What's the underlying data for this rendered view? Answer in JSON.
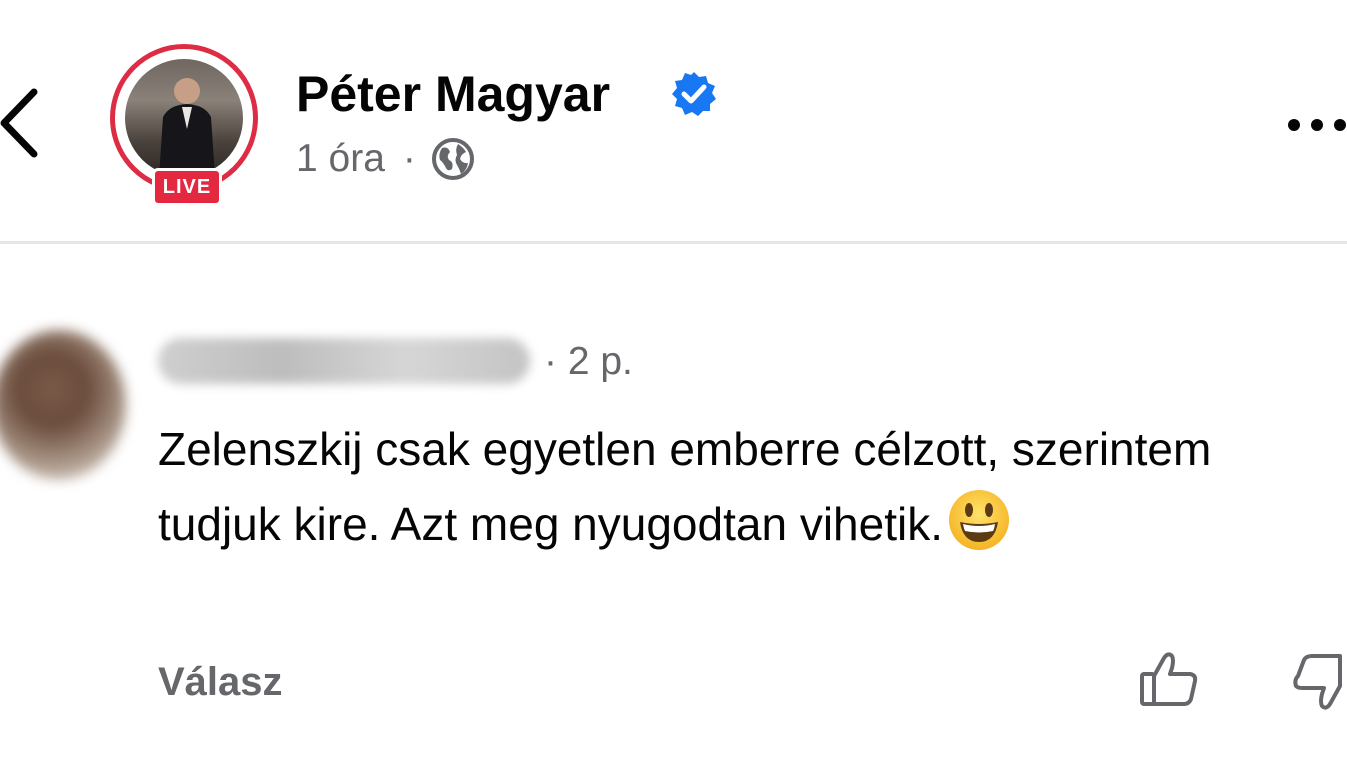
{
  "header": {
    "author_name": "Péter Magyar",
    "live_badge": "LIVE",
    "time_ago": "1 óra",
    "separator": "·",
    "icons": {
      "back": "chevron-left-icon",
      "verified": "verified-badge-icon",
      "audience": "globe-icon",
      "more": "more-horizontal-icon"
    },
    "colors": {
      "live": "#e4283f",
      "verified": "#1877f2"
    }
  },
  "comment": {
    "time_ago": "· 2 p.",
    "text": "Zelenszkij csak egyetlen emberre célzott, szerintem tudjuk kire. Azt meg nyugodtan vihetik.",
    "emoji": "grinning-face-emoji",
    "reply_label": "Válasz",
    "icons": {
      "like": "thumbs-up-icon",
      "dislike": "thumbs-down-icon"
    }
  }
}
